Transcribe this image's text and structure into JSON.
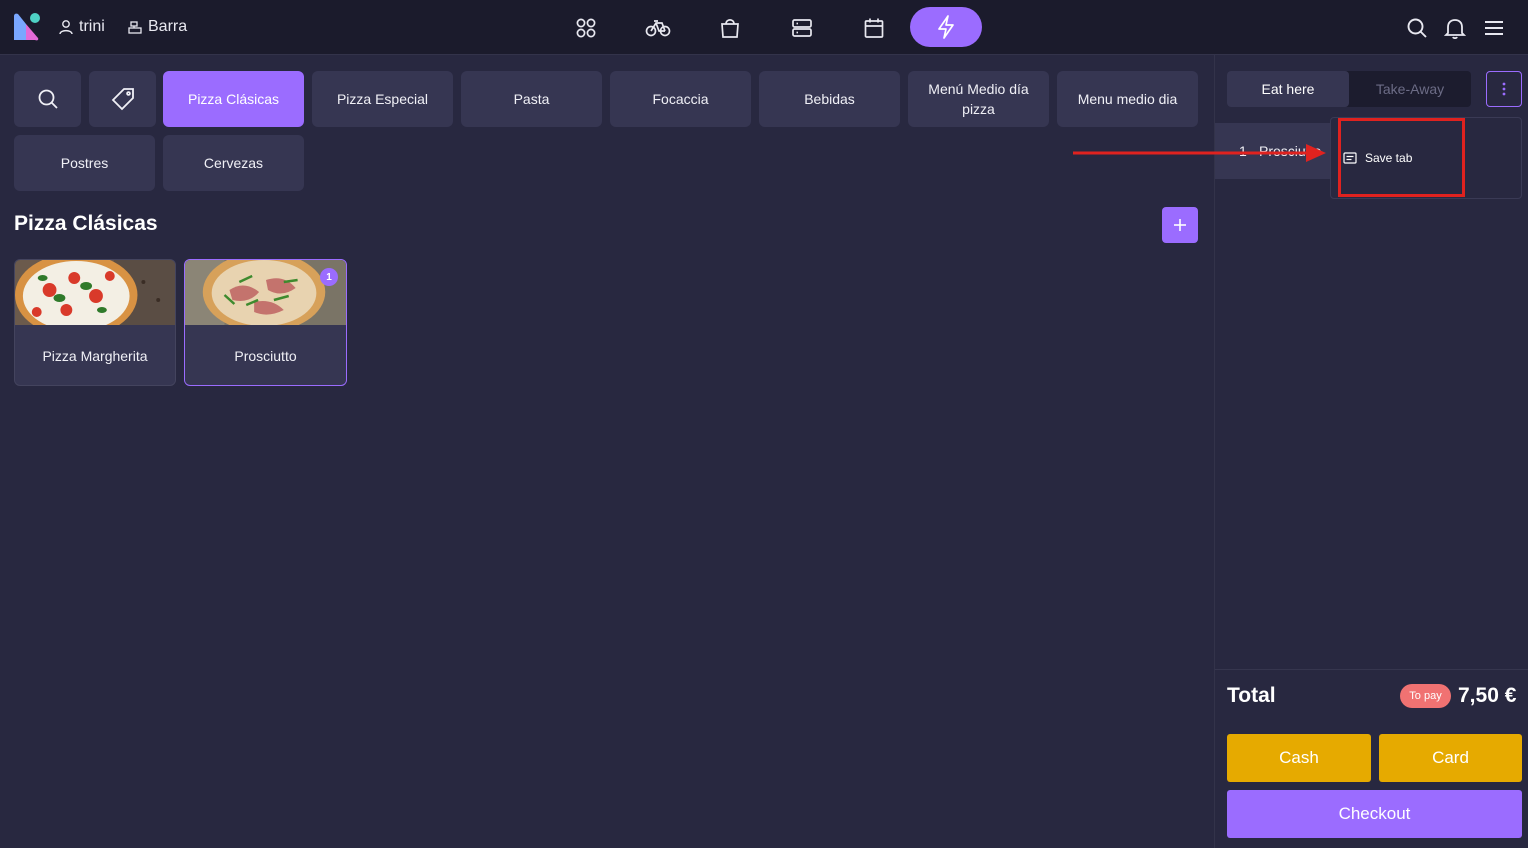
{
  "header": {
    "user_name": "trini",
    "location": "Barra",
    "nav_icons": [
      "grid-icon",
      "bike-icon",
      "bag-icon",
      "server-icon",
      "calendar-icon",
      "lightning-icon"
    ],
    "right_icons": [
      "search-icon",
      "bell-icon",
      "menu-icon"
    ]
  },
  "categories": [
    {
      "label": "Pizza Clásicas",
      "active": true
    },
    {
      "label": "Pizza Especial"
    },
    {
      "label": "Pasta"
    },
    {
      "label": "Focaccia"
    },
    {
      "label": "Bebidas"
    },
    {
      "label": "Menú Medio día pizza"
    },
    {
      "label": "Menu medio dia"
    },
    {
      "label": "Postres"
    },
    {
      "label": "Cervezas"
    }
  ],
  "section": {
    "title": "Pizza Clásicas"
  },
  "products": [
    {
      "name": "Pizza Margherita",
      "count": null
    },
    {
      "name": "Prosciutto",
      "count": "1"
    }
  ],
  "order": {
    "modes": [
      "Eat here",
      "Take-Away"
    ],
    "active_mode": "Eat here",
    "lines": [
      {
        "qty": "1",
        "name": "Prosciutto"
      }
    ],
    "menu": {
      "save_tab": "Save tab"
    }
  },
  "totals": {
    "label": "Total",
    "status": "To pay",
    "amount": "7,50 €"
  },
  "actions": {
    "cash": "Cash",
    "card": "Card",
    "checkout": "Checkout"
  },
  "colors": {
    "accent": "#9b6cff",
    "pay": "#e6aa00",
    "to_pay_badge": "#f07272",
    "annotation": "#e0221f"
  }
}
